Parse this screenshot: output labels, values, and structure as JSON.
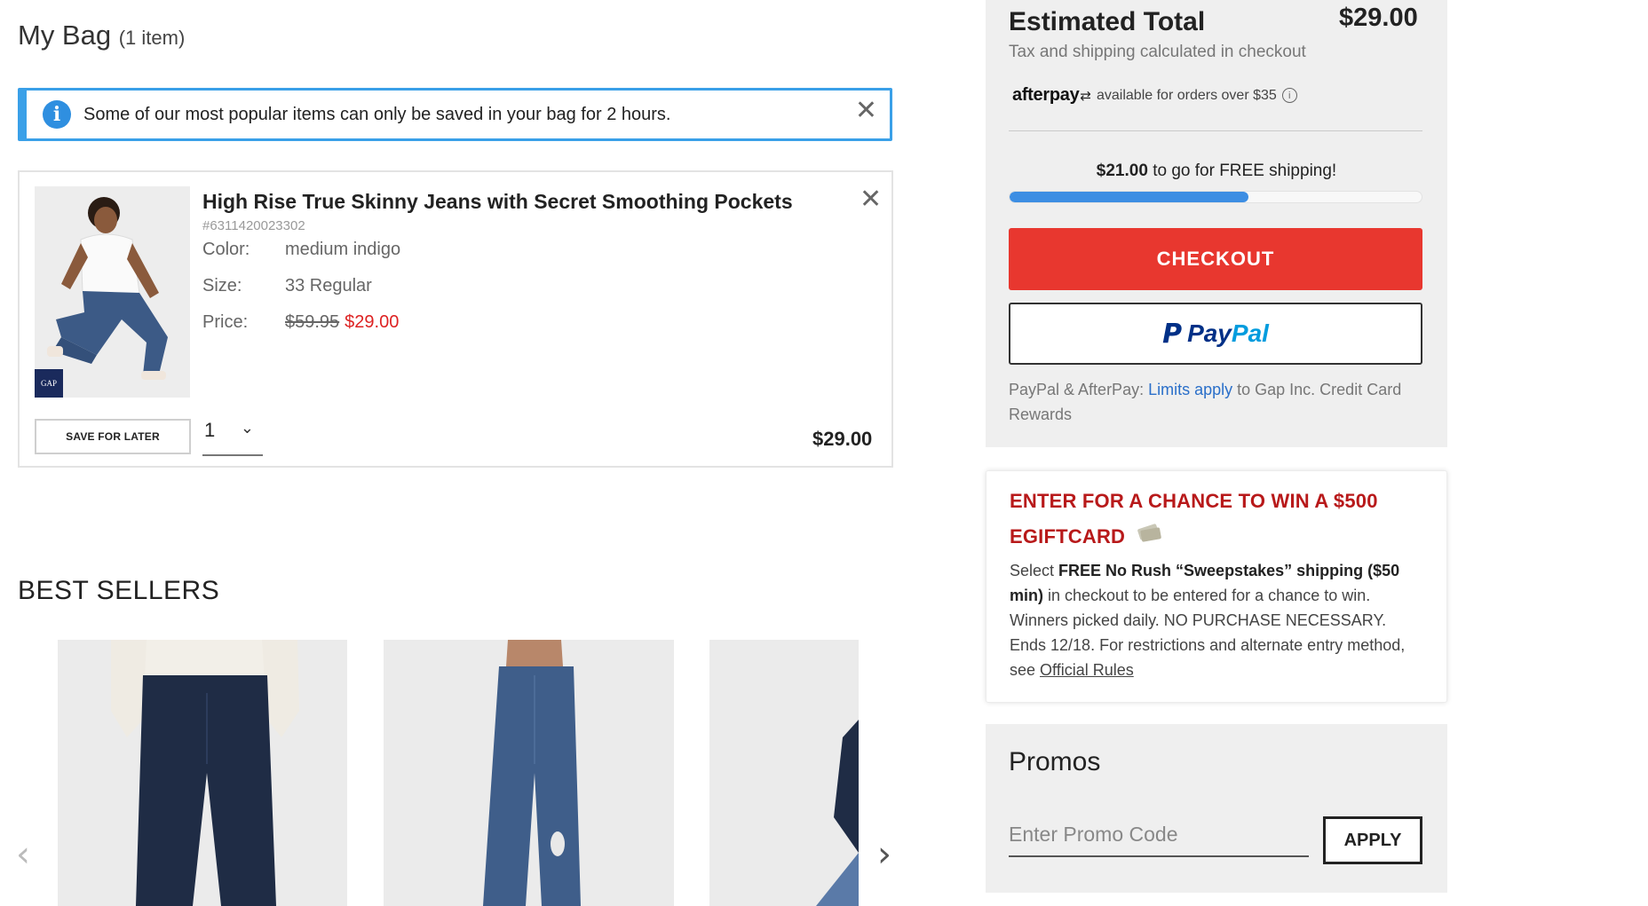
{
  "bag": {
    "title": "My Bag",
    "count_label": "(1 item)"
  },
  "notice": {
    "icon": "info-icon",
    "text": "Some of our most popular items can only be saved in your bag for 2 hours.",
    "close_icon": "close-icon"
  },
  "item": {
    "name": "High Rise True Skinny Jeans with Secret Smoothing Pockets",
    "sku": "#6311420023302",
    "color_label": "Color:",
    "color_value": "medium indigo",
    "size_label": "Size:",
    "size_value": "33 Regular",
    "price_label": "Price:",
    "price_original": "$59.95",
    "price_sale": "$29.00",
    "brand_logo": "GAP",
    "save_later": "SAVE FOR LATER",
    "quantity": "1",
    "line_total": "$29.00"
  },
  "best_sellers": {
    "title": "BEST SELLERS"
  },
  "summary": {
    "est_label": "Estimated Total",
    "est_value": "$29.00",
    "tax_note": "Tax and shipping calculated in checkout",
    "afterpay_logo": "afterpay",
    "afterpay_text": "available for orders over $35",
    "shipping_amount": "$21.00",
    "shipping_text": " to go for FREE shipping!",
    "shipping_progress": 0.58,
    "checkout_label": "CHECKOUT",
    "paypal_pay": "Pay",
    "paypal_pal": "Pal",
    "pp_note_prefix": "PayPal & AfterPay: ",
    "pp_note_link": "Limits apply",
    "pp_note_suffix": " to Gap Inc. Credit Card Rewards"
  },
  "sweepstakes": {
    "title": "ENTER FOR A CHANCE TO WIN A $500 EGIFTCARD",
    "body_1": "Select ",
    "body_bold": "FREE No Rush “Sweepstakes” shipping ($50 min)",
    "body_2": " in checkout to be entered for a chance to win. Winners picked daily. NO PURCHASE NECESSARY. Ends 12/18. For restrictions and alternate entry method, see ",
    "rules_link": "Official Rules"
  },
  "promos": {
    "title": "Promos",
    "placeholder": "Enter Promo Code",
    "apply_label": "APPLY"
  },
  "colors": {
    "checkout": "#e8372f",
    "progress": "#3d8ee3",
    "sale_price": "#dd2222",
    "sweep_title": "#b8191a",
    "notice_border": "#3aa0e8"
  }
}
